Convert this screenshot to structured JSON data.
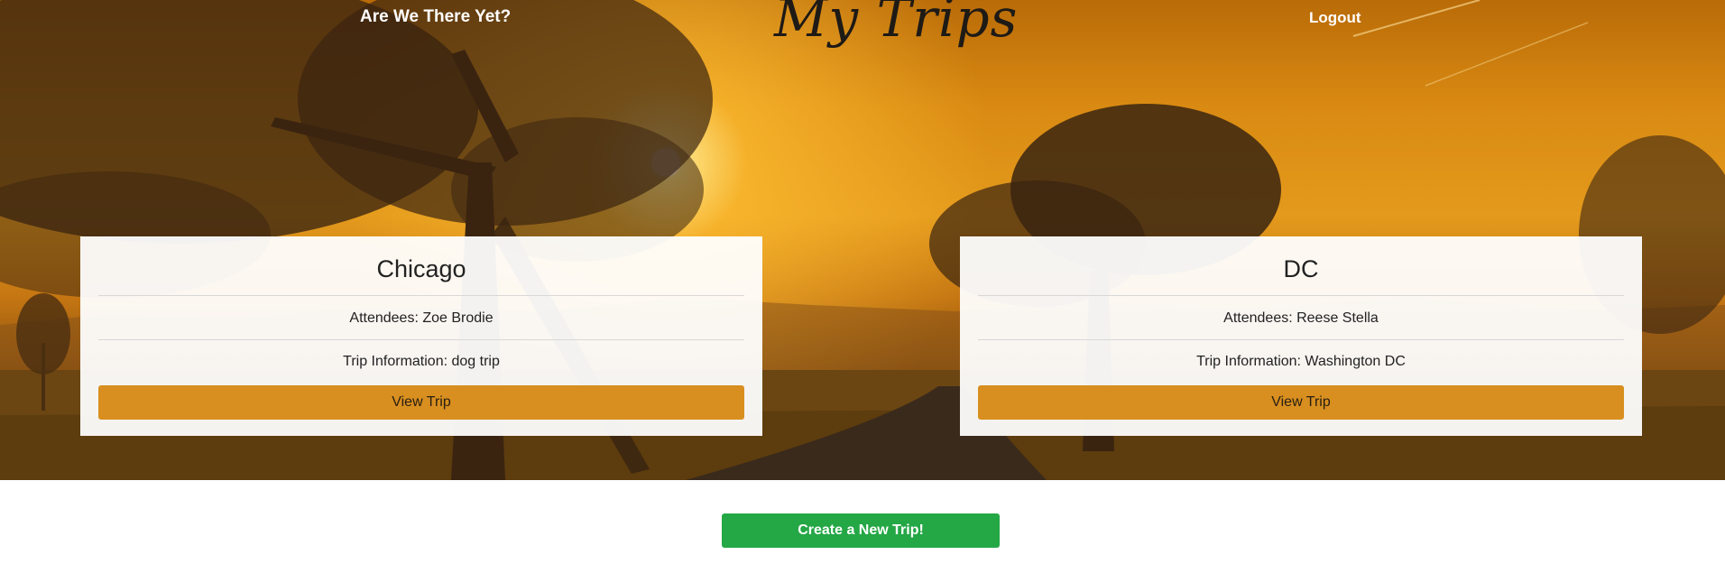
{
  "nav": {
    "brand": "Are We There Yet?",
    "logout": "Logout"
  },
  "page": {
    "title": "My Trips"
  },
  "trips": [
    {
      "name": "Chicago",
      "attendees": "Attendees: Zoe Brodie",
      "info": "Trip Information: dog trip",
      "view_label": "View Trip"
    },
    {
      "name": "DC",
      "attendees": "Attendees: Reese Stella",
      "info": "Trip Information: Washington DC",
      "view_label": "View Trip"
    }
  ],
  "actions": {
    "create_label": "Create a New Trip!"
  },
  "colors": {
    "view_button": "#d88f1f",
    "create_button": "#24a745",
    "sky": "#e49a1c"
  }
}
